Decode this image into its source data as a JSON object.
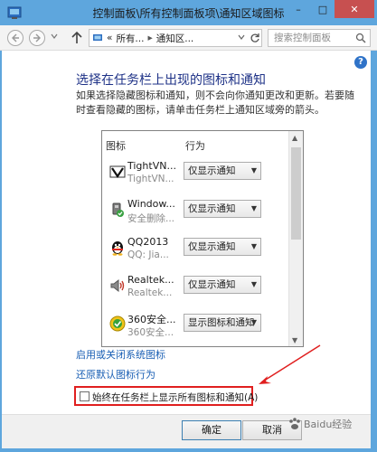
{
  "window": {
    "title": "控制面板\\所有控制面板项\\通知区域图标",
    "controls": {
      "min": "–",
      "max": "□",
      "close": "✕"
    }
  },
  "nav": {
    "breadcrumb": [
      "«",
      "所有...",
      "通知区..."
    ],
    "breadcrumb_sep": "▸",
    "search_placeholder": "搜索控制面板"
  },
  "main": {
    "heading": "选择在任务栏上出现的图标和通知",
    "description": "如果选择隐藏图标和通知，则不会向你通知更改和更新。若要随时查看隐藏的图标，请单击任务栏上通知区域旁的箭头。",
    "help_icon": "?",
    "list": {
      "col_icon": "图标",
      "col_behavior": "行为",
      "rows": [
        {
          "name": "TightVN...",
          "sub": "TightVN...",
          "behavior": "仅显示通知",
          "icon": "tightvnc-icon"
        },
        {
          "name": "Window...",
          "sub": "安全删除...",
          "behavior": "仅显示通知",
          "icon": "usb-device-icon"
        },
        {
          "name": "QQ2013",
          "sub": "QQ: Jia...",
          "behavior": "仅显示通知",
          "icon": "qq-penguin-icon"
        },
        {
          "name": "Realtek...",
          "sub": "Realtek...",
          "behavior": "仅显示通知",
          "icon": "speaker-icon"
        },
        {
          "name": "360安全...",
          "sub": "360安全...",
          "behavior": "显示图标和通知",
          "icon": "360-security-icon"
        }
      ]
    },
    "link_system_icons": "启用或关闭系统图标",
    "link_restore": "还原默认图标行为",
    "checkbox_always_show": "始终在任务栏上显示所有图标和通知(A)",
    "checkbox_checked": false
  },
  "buttons": {
    "ok": "确定",
    "cancel": "取消"
  },
  "watermark": "Baidu经验",
  "colors": {
    "highlight_box": "#e01f1f",
    "heading": "#1e3287",
    "link": "#1a5fb4",
    "window_frame": "#5ea6dd"
  }
}
